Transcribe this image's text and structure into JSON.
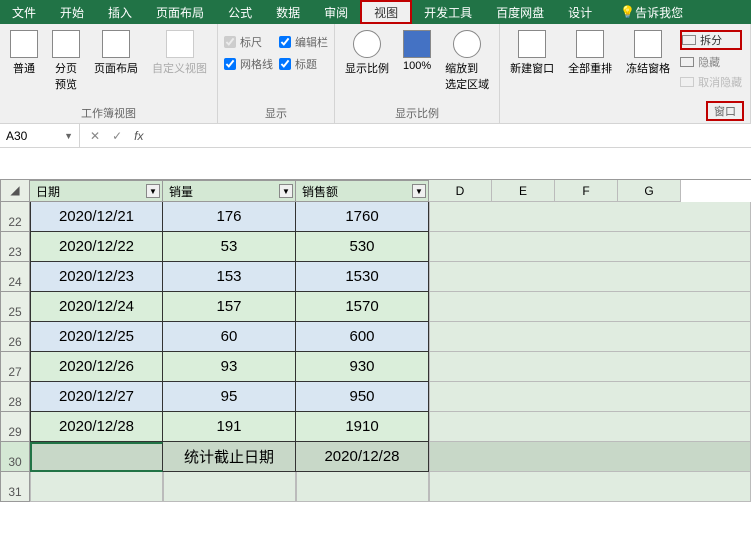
{
  "tabs": {
    "file": "文件",
    "home": "开始",
    "insert": "插入",
    "layout": "页面布局",
    "formulas": "公式",
    "data": "数据",
    "review": "审阅",
    "view": "视图",
    "dev": "开发工具",
    "baidu": "百度网盘",
    "design": "设计",
    "tell": "告诉我您"
  },
  "ribbon": {
    "views": {
      "normal": "普通",
      "pagebreak": "分页\n预览",
      "pagelayout": "页面布局",
      "custom": "自定义视图",
      "group": "工作簿视图"
    },
    "show": {
      "ruler": "标尺",
      "formulabar": "编辑栏",
      "gridlines": "网格线",
      "headings": "标题",
      "group": "显示"
    },
    "zoom": {
      "zoom": "显示比例",
      "hundred": "100%",
      "selection": "缩放到\n选定区域",
      "group": "显示比例"
    },
    "window": {
      "new": "新建窗口",
      "arrange": "全部重排",
      "freeze": "冻结窗格",
      "split": "拆分",
      "hide": "隐藏",
      "unhide": "取消隐藏",
      "group": "窗口"
    }
  },
  "formula": {
    "cellref": "A30",
    "fx": "fx"
  },
  "headers": {
    "date": "日期",
    "qty": "销量",
    "amt": "销售额",
    "d": "D",
    "e": "E",
    "f": "F",
    "g": "G"
  },
  "rows": [
    {
      "n": "22",
      "date": "2020/12/21",
      "qty": "176",
      "amt": "1760",
      "cls": "blue"
    },
    {
      "n": "23",
      "date": "2020/12/22",
      "qty": "53",
      "amt": "530",
      "cls": "green"
    },
    {
      "n": "24",
      "date": "2020/12/23",
      "qty": "153",
      "amt": "1530",
      "cls": "blue"
    },
    {
      "n": "25",
      "date": "2020/12/24",
      "qty": "157",
      "amt": "1570",
      "cls": "green"
    },
    {
      "n": "26",
      "date": "2020/12/25",
      "qty": "60",
      "amt": "600",
      "cls": "blue"
    },
    {
      "n": "27",
      "date": "2020/12/26",
      "qty": "93",
      "amt": "930",
      "cls": "green"
    },
    {
      "n": "28",
      "date": "2020/12/27",
      "qty": "95",
      "amt": "950",
      "cls": "blue"
    },
    {
      "n": "29",
      "date": "2020/12/28",
      "qty": "191",
      "amt": "1910",
      "cls": "green"
    }
  ],
  "summary": {
    "n": "30",
    "label": "统计截止日期",
    "value": "2020/12/28"
  },
  "blank": {
    "n": "31"
  }
}
